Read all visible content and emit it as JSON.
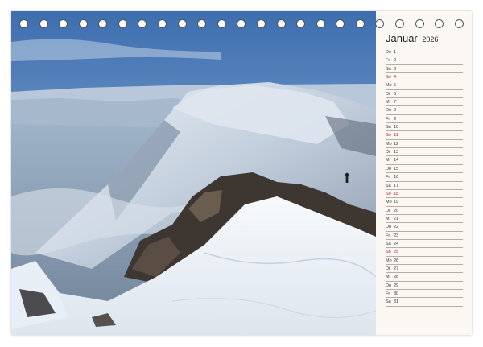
{
  "calendar": {
    "month": "Januar",
    "year": "2026",
    "days": [
      {
        "wd": "Do",
        "d": "1",
        "sunday": false
      },
      {
        "wd": "Fr",
        "d": "2",
        "sunday": false
      },
      {
        "wd": "Sa",
        "d": "3",
        "sunday": false
      },
      {
        "wd": "So",
        "d": "4",
        "sunday": true
      },
      {
        "wd": "Mo",
        "d": "5",
        "sunday": false
      },
      {
        "wd": "Di",
        "d": "6",
        "sunday": false
      },
      {
        "wd": "Mi",
        "d": "7",
        "sunday": false
      },
      {
        "wd": "Do",
        "d": "8",
        "sunday": false
      },
      {
        "wd": "Fr",
        "d": "9",
        "sunday": false
      },
      {
        "wd": "Sa",
        "d": "10",
        "sunday": false
      },
      {
        "wd": "So",
        "d": "11",
        "sunday": true
      },
      {
        "wd": "Mo",
        "d": "12",
        "sunday": false
      },
      {
        "wd": "Di",
        "d": "13",
        "sunday": false
      },
      {
        "wd": "Mi",
        "d": "14",
        "sunday": false
      },
      {
        "wd": "Do",
        "d": "15",
        "sunday": false
      },
      {
        "wd": "Fr",
        "d": "16",
        "sunday": false
      },
      {
        "wd": "Sa",
        "d": "17",
        "sunday": false
      },
      {
        "wd": "So",
        "d": "18",
        "sunday": true
      },
      {
        "wd": "Mo",
        "d": "19",
        "sunday": false
      },
      {
        "wd": "Di",
        "d": "20",
        "sunday": false
      },
      {
        "wd": "Mi",
        "d": "21",
        "sunday": false
      },
      {
        "wd": "Do",
        "d": "22",
        "sunday": false
      },
      {
        "wd": "Fr",
        "d": "23",
        "sunday": false
      },
      {
        "wd": "Sa",
        "d": "24",
        "sunday": false
      },
      {
        "wd": "So",
        "d": "25",
        "sunday": true
      },
      {
        "wd": "Mo",
        "d": "26",
        "sunday": false
      },
      {
        "wd": "Di",
        "d": "27",
        "sunday": false
      },
      {
        "wd": "Mi",
        "d": "28",
        "sunday": false
      },
      {
        "wd": "Do",
        "d": "29",
        "sunday": false
      },
      {
        "wd": "Fr",
        "d": "30",
        "sunday": false
      },
      {
        "wd": "Sa",
        "d": "31",
        "sunday": false
      }
    ]
  },
  "binding_rings": 23,
  "colors": {
    "sunday": "#c8102e",
    "rule_line": "#b9aea4",
    "panel_bg": "#fbf8f4",
    "sky_top": "#3f6fae",
    "snow": "#f3f6fa"
  },
  "photo": {
    "icon": "snowy-mountain-ridge-photo"
  }
}
